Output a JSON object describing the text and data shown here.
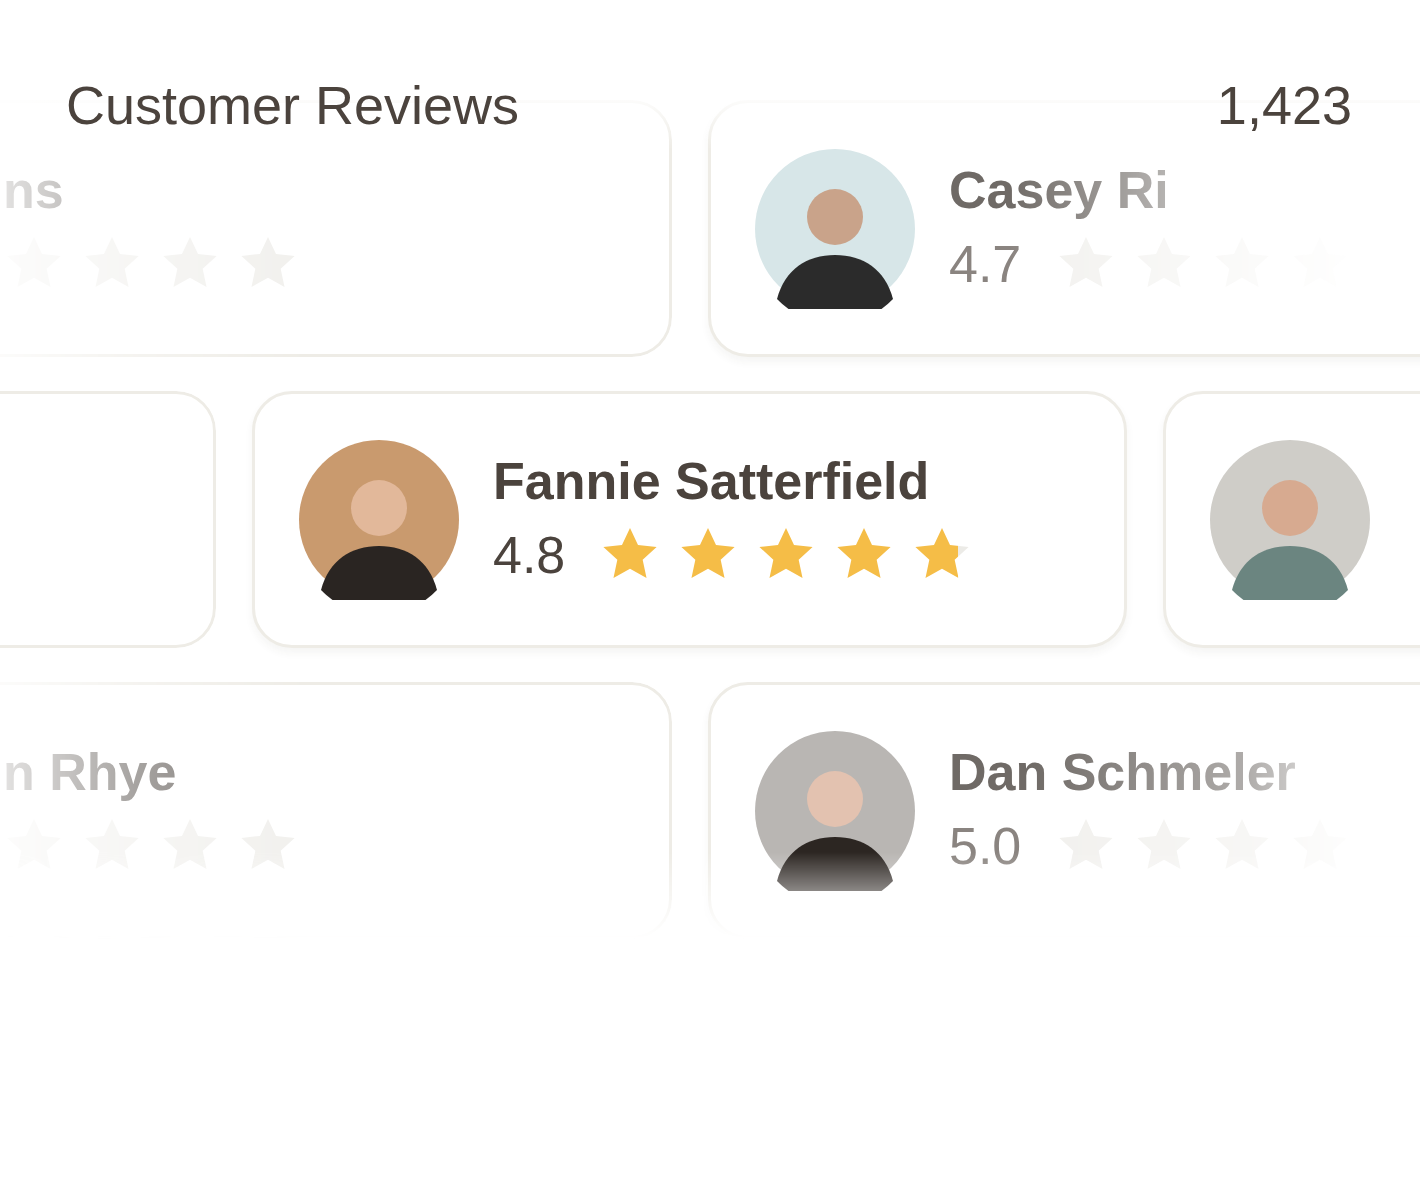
{
  "header": {
    "title": "Customer Reviews",
    "count": "1,423"
  },
  "rows": [
    {
      "cards": [
        {
          "kind": "faded",
          "name": "ns"
        },
        {
          "kind": "faded",
          "name": "Casey Ri",
          "rating": "4.7"
        }
      ]
    },
    {
      "cards": [
        {
          "kind": "empty"
        },
        {
          "kind": "focus",
          "name": "Fannie Satterfield",
          "rating": "4.8",
          "stars": 4.8
        },
        {
          "kind": "empty"
        }
      ]
    },
    {
      "cards": [
        {
          "kind": "faded",
          "name": "n Rhye"
        },
        {
          "kind": "faded",
          "name": "Dan Schmeler",
          "rating": "5.0"
        }
      ]
    }
  ]
}
